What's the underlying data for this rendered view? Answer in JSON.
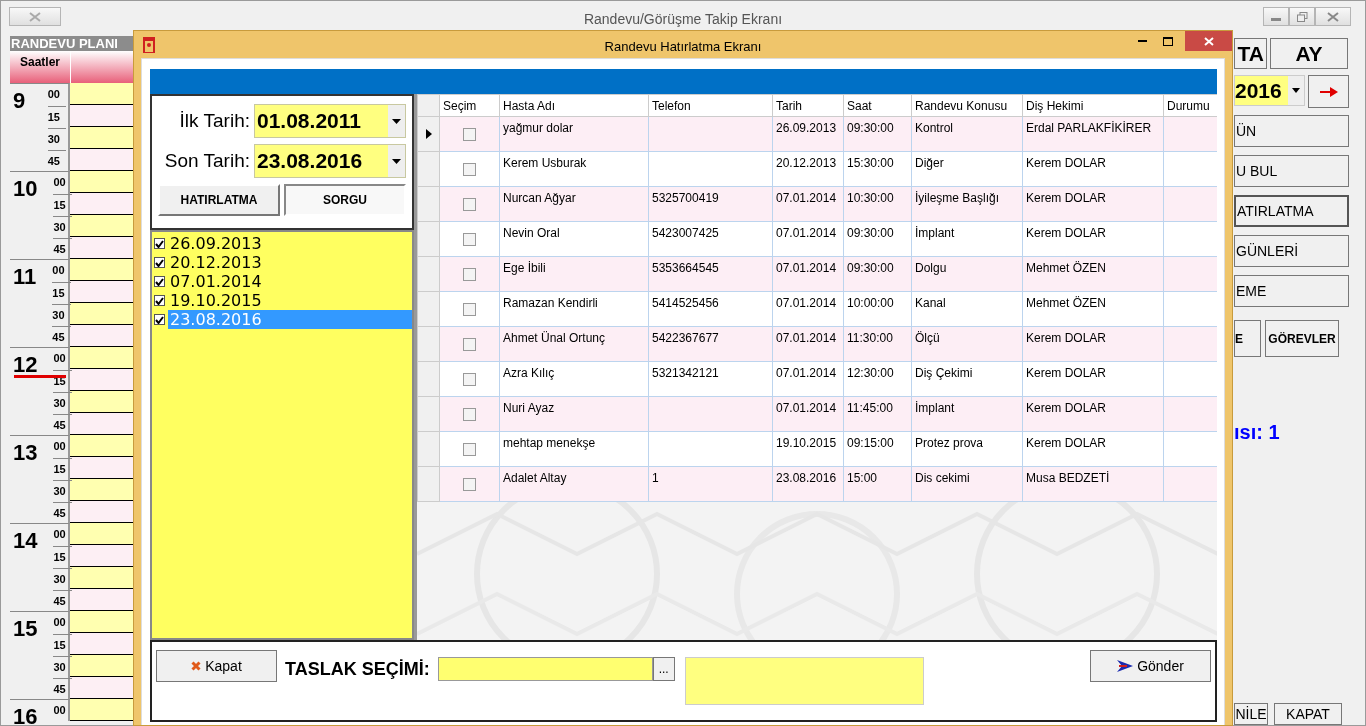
{
  "main_window": {
    "title": "Randevu/Görüşme Takip Ekranı"
  },
  "schedule": {
    "title": "RANDEVU PLANI",
    "hours_header": "Saatler",
    "hours": [
      {
        "hour": "9",
        "minutes": [
          "00",
          "15",
          "30",
          "45"
        ],
        "current": false
      },
      {
        "hour": "10",
        "minutes": [
          "00",
          "15",
          "30",
          "45"
        ],
        "current": false
      },
      {
        "hour": "11",
        "minutes": [
          "00",
          "15",
          "30",
          "45"
        ],
        "current": false
      },
      {
        "hour": "12",
        "minutes": [
          "00",
          "15",
          "30",
          "45"
        ],
        "current": true
      },
      {
        "hour": "13",
        "minutes": [
          "00",
          "15",
          "30",
          "45"
        ],
        "current": false
      },
      {
        "hour": "14",
        "minutes": [
          "00",
          "15",
          "30",
          "45"
        ],
        "current": false
      },
      {
        "hour": "15",
        "minutes": [
          "00",
          "15",
          "30",
          "45"
        ],
        "current": false
      },
      {
        "hour": "16",
        "minutes": [
          "00"
        ],
        "current": false
      }
    ]
  },
  "right_panel": {
    "view_buttons": [
      "TA",
      "AY"
    ],
    "year_field": "2016",
    "menu_buttons": [
      "ÜN",
      "U BUL",
      "ATIRLATMA",
      "GÜNLERİ",
      "EME"
    ],
    "small_buttons": [
      "E",
      "GÖREVLER"
    ],
    "count_text": "ısı: 1",
    "bottom_buttons": [
      "NİLE",
      "KAPAT"
    ]
  },
  "dialog": {
    "title": "Randevu Hatırlatma Ekranı",
    "filter": {
      "first_date_label": "İlk Tarih:",
      "first_date": "01.08.2011",
      "last_date_label": "Son Tarih:",
      "last_date": "23.08.2016",
      "buttons": [
        {
          "label": "HATIRLATMA",
          "selected": false
        },
        {
          "label": "SORGU",
          "selected": true
        }
      ]
    },
    "dates": [
      {
        "date": "26.09.2013",
        "checked": true,
        "selected": false
      },
      {
        "date": "20.12.2013",
        "checked": true,
        "selected": false
      },
      {
        "date": "07.01.2014",
        "checked": true,
        "selected": false
      },
      {
        "date": "19.10.2015",
        "checked": true,
        "selected": false
      },
      {
        "date": "23.08.2016",
        "checked": true,
        "selected": true
      }
    ],
    "table": {
      "columns": [
        "Seçim",
        "Hasta Adı",
        "Telefon",
        "Tarih",
        "Saat",
        "Randevu Konusu",
        "Diş Hekimi",
        "Durumu"
      ],
      "rows": [
        {
          "current": true,
          "checked": false,
          "cells": [
            "",
            "yağmur dolar",
            "",
            "26.09.2013",
            "09:30:00",
            "Kontrol",
            "Erdal PARLAKFİKİRER",
            ""
          ]
        },
        {
          "current": false,
          "checked": false,
          "cells": [
            "",
            "Kerem Usburak",
            "",
            "20.12.2013",
            "15:30:00",
            "Diğer",
            "Kerem DOLAR",
            ""
          ]
        },
        {
          "current": false,
          "checked": false,
          "cells": [
            "",
            "Nurcan Ağyar",
            "5325700419",
            "07.01.2014",
            "10:30:00",
            "İyileşme Başlığı",
            "Kerem DOLAR",
            ""
          ]
        },
        {
          "current": false,
          "checked": false,
          "cells": [
            "",
            "Nevin Oral",
            "5423007425",
            "07.01.2014",
            "09:30:00",
            "İmplant",
            "Kerem DOLAR",
            ""
          ]
        },
        {
          "current": false,
          "checked": false,
          "cells": [
            "",
            "Ege İbili",
            "5353664545",
            "07.01.2014",
            "09:30:00",
            "Dolgu",
            "Mehmet ÖZEN",
            ""
          ]
        },
        {
          "current": false,
          "checked": false,
          "cells": [
            "",
            "Ramazan Kendirli",
            "5414525456",
            "07.01.2014",
            "10:00:00",
            "Kanal",
            "Mehmet ÖZEN",
            ""
          ]
        },
        {
          "current": false,
          "checked": false,
          "cells": [
            "",
            "Ahmet Ünal Ortunç",
            "5422367677",
            "07.01.2014",
            "11:30:00",
            "Ölçü",
            "Kerem DOLAR",
            ""
          ]
        },
        {
          "current": false,
          "checked": false,
          "cells": [
            "",
            "Azra Kılıç",
            "5321342121",
            "07.01.2014",
            "12:30:00",
            "Diş Çekimi",
            "Kerem DOLAR",
            ""
          ]
        },
        {
          "current": false,
          "checked": false,
          "cells": [
            "",
            "Nuri Ayaz",
            "",
            "07.01.2014",
            "11:45:00",
            "İmplant",
            "Kerem DOLAR",
            ""
          ]
        },
        {
          "current": false,
          "checked": false,
          "cells": [
            "",
            "mehtap menekşe",
            "",
            "19.10.2015",
            "09:15:00",
            "Protez prova",
            "Kerem DOLAR",
            ""
          ]
        },
        {
          "current": false,
          "checked": false,
          "cells": [
            "",
            "Adalet Altay",
            "1",
            "23.08.2016",
            "15:00",
            "Dis cekimi",
            "Musa BEDZETİ",
            ""
          ]
        }
      ]
    },
    "bottom": {
      "close_button": "Kapat",
      "template_label": "TASLAK SEÇİMİ:",
      "browse_button": "...",
      "send_button": "Gönder"
    }
  }
}
